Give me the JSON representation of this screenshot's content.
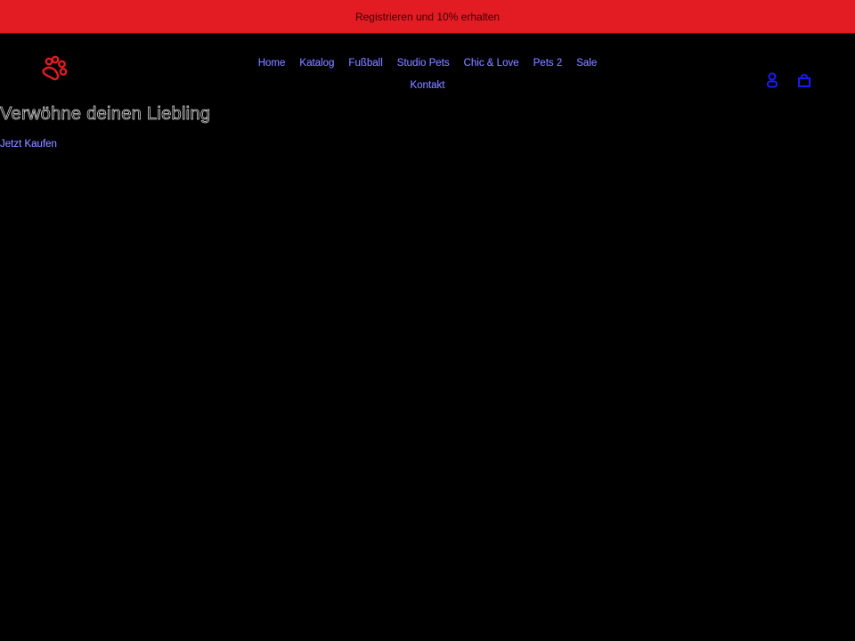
{
  "announcement": {
    "text": "Registrieren und 10% erhalten",
    "background": "#e31b23"
  },
  "header": {
    "logo": {
      "icon": "paw-icon",
      "color": "#e31b23"
    },
    "nav": [
      {
        "label": "Home"
      },
      {
        "label": "Katalog"
      },
      {
        "label": "Fußball"
      },
      {
        "label": "Studio Pets"
      },
      {
        "label": "Chic & Love"
      },
      {
        "label": "Pets 2"
      },
      {
        "label": "Sale"
      },
      {
        "label": "Kontakt"
      }
    ],
    "icons": [
      {
        "name": "account-icon",
        "color": "#1a1aff"
      },
      {
        "name": "cart-icon",
        "color": "#1a1aff"
      }
    ]
  },
  "hero": {
    "title": "Verwöhne deinen Liebling",
    "cta_label": "Jetzt Kaufen"
  }
}
